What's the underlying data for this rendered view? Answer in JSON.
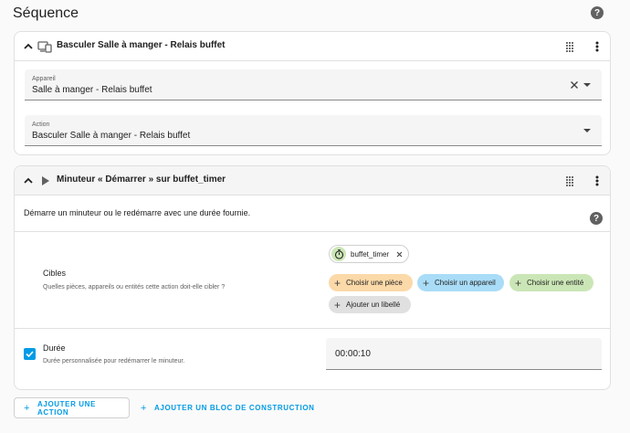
{
  "page": {
    "title": "Séquence"
  },
  "action1": {
    "title": "Basculer Salle à manger - Relais buffet",
    "device_label": "Appareil",
    "device_value": "Salle à manger - Relais buffet",
    "action_label": "Action",
    "action_value": "Basculer Salle à manger - Relais buffet"
  },
  "action2": {
    "title": "Minuteur « Démarrer » sur buffet_timer",
    "description": "Démarre un minuteur ou le redémarre avec une durée fournie.",
    "targets": {
      "label": "Cibles",
      "helper": "Quelles pièces, appareils ou entités cette action doit-elle cibler ?",
      "selected_chip": "buffet_timer",
      "buttons": {
        "area": "Choisir une pièce",
        "device": "Choisir un appareil",
        "entity": "Choisir une entité",
        "label": "Ajouter un libellé"
      }
    },
    "duration": {
      "label": "Durée",
      "helper": "Durée personnalisée pour redémarrer le minuteur.",
      "value": "00:00:10",
      "checked": true
    }
  },
  "footer": {
    "add_action": "AJOUTER UNE ACTION",
    "add_block": "AJOUTER UN BLOC DE CONSTRUCTION"
  },
  "colors": {
    "accent": "#039be5",
    "chip_area": "#fbd9a8",
    "chip_device": "#a9dcf7",
    "chip_entity": "#cbe6b6",
    "chip_label": "#e0e0e0"
  }
}
